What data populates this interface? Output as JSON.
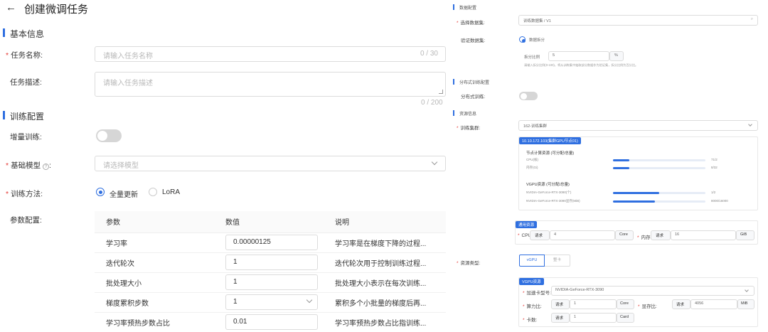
{
  "header": {
    "title": "创建微调任务"
  },
  "basic": {
    "section_title": "基本信息",
    "name_label": "任务名称:",
    "name_placeholder": "请输入任务名称",
    "name_counter": "0 / 30",
    "desc_label": "任务描述:",
    "desc_placeholder": "请输入任务描述",
    "desc_counter": "0 / 200"
  },
  "training": {
    "section_title": "训练配置",
    "incremental_label": "增量训练:",
    "base_model_label": "基础模型",
    "base_model_colon": ":",
    "base_model_placeholder": "请选择模型",
    "method_label": "训练方法:",
    "method_options": [
      "全量更新",
      "LoRA"
    ],
    "params_label": "参数配置:",
    "params_table": {
      "headers": [
        "参数",
        "数值",
        "说明"
      ],
      "rows": [
        {
          "name": "学习率",
          "value": "0.00000125",
          "desc": "学习率是在梯度下降的过程..."
        },
        {
          "name": "迭代轮次",
          "value": "1",
          "desc": "迭代轮次用于控制训练过程..."
        },
        {
          "name": "批处理大小",
          "value": "1",
          "desc": "批处理大小表示在每次训练..."
        },
        {
          "name": "梯度累积步数",
          "value": "1",
          "desc": "累积多个小批量的梯度后再..."
        },
        {
          "name": "学习率预热步数占比",
          "value": "0.01",
          "desc": "学习率预热步数占比指训练..."
        }
      ]
    }
  },
  "right": {
    "data_section": "数据配置",
    "dataset_label": "选择数据集:",
    "dataset_value": "训练数据集 / V1",
    "val_label": "验证数据集:",
    "val_option": "数据拆分",
    "split_label": "拆分比例",
    "split_value": "5",
    "split_unit": "%",
    "split_hint": "请输入拆分比例(0-100)，将从训练集中抽取部分数据作为验证集，拆分比例为百分比。",
    "dist_section": "分布式训练配置",
    "dist_label": "分布式训练:",
    "res_section": "资源信息",
    "cluster_label": "训练集群:",
    "cluster_value": "162-训练集群",
    "node_badge": "10.10.172.103(集群GPU节点01)",
    "node_res_title": "节点计算资源 (可分配/总量)",
    "cpu_label": "CPU(核)",
    "cpu_value": "71/2",
    "mem_label": "内存(Gi)",
    "mem_value": "8/32",
    "cpu_fill": 0.18,
    "mem_fill": 0.18,
    "vgpu_title": "VGPU资源 (可分配/总量)",
    "gpu1_label": "NVIDIA-GeForce-RTX-3090(个)",
    "gpu1_value": "1/2",
    "gpu2_label": "NVIDIA-GeForce-RTX-3090显存(MiB)",
    "gpu2_value": "8000/16000",
    "gpu1_fill": 0.5,
    "gpu2_fill": 0.45,
    "cpu_section_badge": "通用资源",
    "cpu_field_label": "CPU:",
    "cpu_request_label": "请求",
    "cpu_request_value": "4",
    "cpu_unit": "Core",
    "mem_field_label": "内存:",
    "mem_request_label": "请求",
    "mem_request_value": "16",
    "mem_unit": "GiB",
    "res_type_label": "资源类型:",
    "res_types": [
      "vGPU",
      "整卡"
    ],
    "vgpu_badge": "VGPU资源",
    "gpu_model_label": "加速卡型号:",
    "gpu_model_value": "NVIDIA-GeForce-RTX-3090",
    "gpu_core_label": "算力比:",
    "gpu_core_request": "请求",
    "gpu_core_value": "1",
    "gpu_core_unit": "Core",
    "gpu_mem_label": "显存比:",
    "gpu_mem_request": "请求",
    "gpu_mem_value": "4056",
    "gpu_mem_unit": "MiB",
    "gpu_count_label": "卡数:",
    "gpu_count_request": "请求",
    "gpu_count_value": "1",
    "gpu_count_unit": "Card"
  },
  "colors": {
    "accent": "#2f6fe0",
    "required": "#e53935"
  },
  "icons": [
    "back-arrow-icon",
    "help-circle-icon",
    "chevron-down-icon",
    "resize-grip-icon"
  ]
}
